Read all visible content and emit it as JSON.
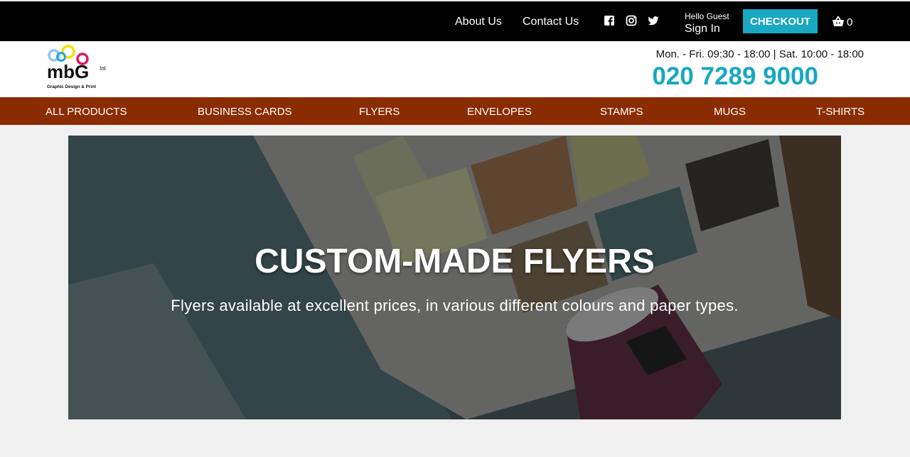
{
  "topbar": {
    "about_label": "About Us",
    "contact_label": "Contact Us",
    "social_icons": [
      "facebook-icon",
      "instagram-icon",
      "twitter-icon"
    ],
    "hello_text": "Hello Guest",
    "signin_label": "Sign In",
    "checkout_label": "CHECKOUT",
    "cart_count": "0"
  },
  "header": {
    "hours": "Mon. - Fri. 09:30 - 18:00 | Sat. 10:00 - 18:00",
    "phone": "020 7289 9000",
    "logo_text": "mbG",
    "logo_suffix": "Int",
    "logo_tagline": "Graphic Design & Print"
  },
  "nav": {
    "items": [
      {
        "label": "ALL PRODUCTS"
      },
      {
        "label": "BUSINESS CARDS"
      },
      {
        "label": "FLYERS"
      },
      {
        "label": "ENVELOPES"
      },
      {
        "label": "STAMPS"
      },
      {
        "label": "MUGS"
      },
      {
        "label": "T-SHIRTS"
      }
    ]
  },
  "hero": {
    "title": "CUSTOM-MADE FLYERS",
    "subtitle": "Flyers available at excellent prices, in various different colours and paper types."
  },
  "colors": {
    "accent": "#19a7c1",
    "nav_bg": "#8a2c02",
    "topbar_bg": "#000000",
    "page_bg": "#f0f0f0"
  }
}
